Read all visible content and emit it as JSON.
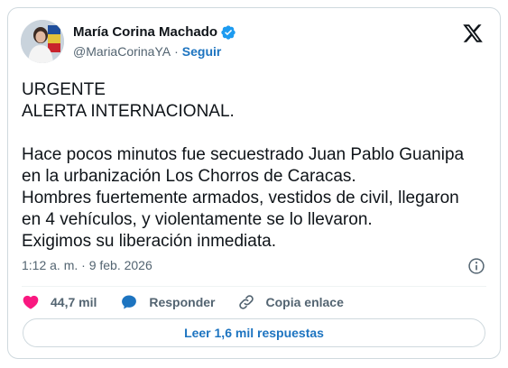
{
  "author": {
    "display_name": "María Corina Machado",
    "handle": "@MariaCorinaYA",
    "separator": "·",
    "follow_label": "Seguir"
  },
  "tweet": {
    "lines": [
      "URGENTE",
      "ALERTA INTERNACIONAL.",
      "",
      "Hace pocos minutos fue secuestrado Juan Pablo Guanipa",
      "en la urbanización Los Chorros de Caracas.",
      "Hombres fuertemente armados, vestidos de civil, llegaron",
      "en 4 vehículos, y violentamente se lo llevaron.",
      "Exigimos su liberación inmediata."
    ],
    "timestamp": "1:12 a. m. · 9 feb. 2026"
  },
  "actions": {
    "likes_count": "44,7 mil",
    "reply_label": "Responder",
    "copy_link_label": "Copia enlace"
  },
  "read_replies_label": "Leer 1,6 mil respuestas",
  "icons": {
    "verified": "verified-badge-icon",
    "logo": "x-logo-icon",
    "info": "info-icon",
    "like": "heart-icon",
    "reply": "speech-bubble-icon",
    "copy_link": "link-icon"
  },
  "colors": {
    "accent": "#1d74c0",
    "verified": "#1d9bf0",
    "like": "#f91880",
    "text": "#0f1419",
    "muted": "#536471",
    "border": "#cfd9de"
  }
}
